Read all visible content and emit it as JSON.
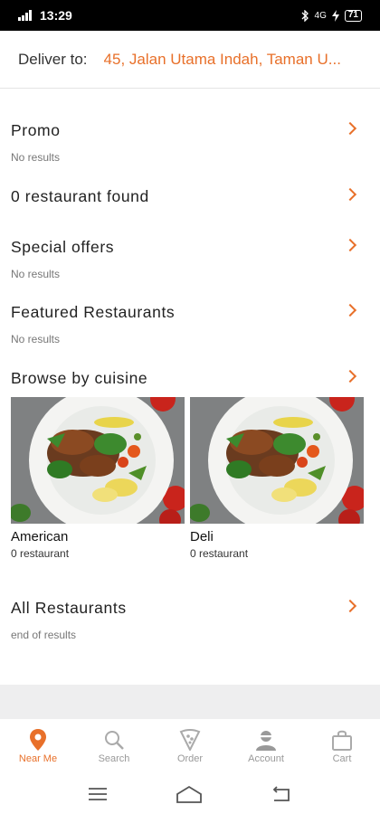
{
  "status": {
    "time": "13:29",
    "network": "4G",
    "battery": "71"
  },
  "header": {
    "deliver_label": "Deliver to:",
    "address": "45, Jalan Utama Indah, Taman U..."
  },
  "sections": {
    "promo": {
      "title": "Promo",
      "subtitle": "No results"
    },
    "restaurant_found": {
      "title": "0 restaurant found"
    },
    "special_offers": {
      "title": "Special offers",
      "subtitle": "No results"
    },
    "featured": {
      "title": "Featured Restaurants",
      "subtitle": "No results"
    },
    "browse": {
      "title": "Browse by cuisine"
    },
    "all": {
      "title": "All Restaurants",
      "subtitle": "end of results"
    }
  },
  "cuisines": [
    {
      "name": "American",
      "count": "0 restaurant"
    },
    {
      "name": "Deli",
      "count": "0 restaurant"
    }
  ],
  "bottom_nav": [
    {
      "label": "Near Me",
      "icon": "location-pin-icon",
      "active": true
    },
    {
      "label": "Search",
      "icon": "search-icon",
      "active": false
    },
    {
      "label": "Order",
      "icon": "pizza-icon",
      "active": false
    },
    {
      "label": "Account",
      "icon": "account-icon",
      "active": false
    },
    {
      "label": "Cart",
      "icon": "cart-icon",
      "active": false
    }
  ],
  "colors": {
    "accent": "#e8702a",
    "inactive": "#999999"
  }
}
